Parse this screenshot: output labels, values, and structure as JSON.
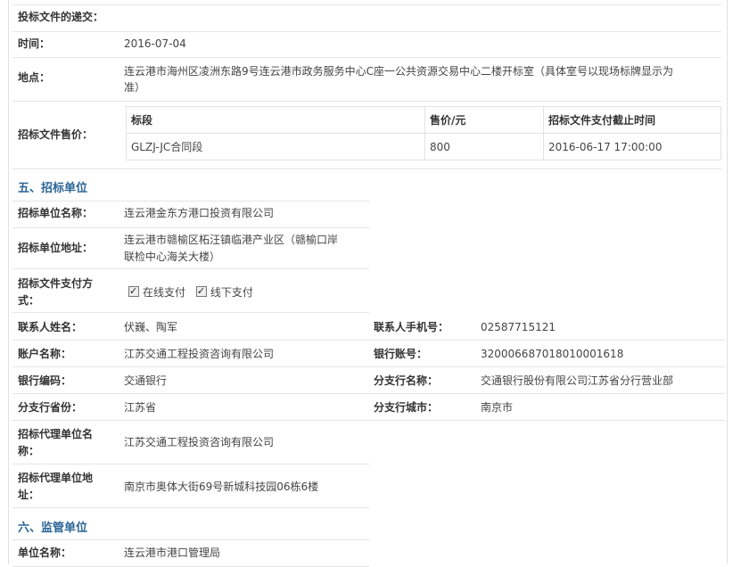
{
  "submission": {
    "label": "投标文件的递交："
  },
  "time": {
    "label": "时间：",
    "value": "2016-07-04"
  },
  "location": {
    "label": "地点：",
    "value_line1": "连云港市海州区凌洲东路9号连云港市政务服务中心C座一公共资源交易中心二楼开标室（具体室号以现场标牌显示为",
    "value_line2": "准）"
  },
  "price": {
    "label": "招标文件售价：",
    "headers": [
      "标段",
      "售价/元",
      "招标文件支付截止时间"
    ],
    "rows": [
      [
        "GLZJ-JC合同段",
        "800",
        "2016-06-17 17:00:00"
      ]
    ]
  },
  "section5": {
    "title": "五、招标单位"
  },
  "tenderer": {
    "name_label": "招标单位名称：",
    "name": "连云港金东方港口投资有限公司",
    "addr_label": "招标单位地址：",
    "addr_line1": "连云港市赣榆区柘汪镇临港产业区（赣榆口岸",
    "addr_line2": "联检中心海关大楼）",
    "pay_label_line1": "招标文件支付方",
    "pay_label_line2": "式：",
    "pay_online": "在线支付",
    "pay_offline": "线下支付",
    "contact_label": "联系人姓名：",
    "contact": "伏巍、陶军",
    "phone_label": "联系人手机号：",
    "phone": "02587715121",
    "account_name_label": "账户名称：",
    "account_name": "江苏交通工程投资咨询有限公司",
    "account_no_label": "银行账号：",
    "account_no": "32000668701801000161​8",
    "bank_code_label": "银行编码：",
    "bank_code": "交通银行",
    "branch_label": "分支行名称：",
    "branch": "交通银行股份有限公司江苏省分行营业部",
    "province_label": "分支行省份：",
    "province": "江苏省",
    "city_label": "分支行城市：",
    "city": "南京市",
    "agent_label_line1": "招标代理单位名",
    "agent_label_line2": "称：",
    "agent": "江苏交通工程投资咨询有限公司",
    "agent_addr_label_line1": "招标代理单位地",
    "agent_addr_label_line2": "址：",
    "agent_addr": "南京市奥体大街69号新城科技园06栋6楼"
  },
  "section6": {
    "title": "六、监管单位"
  },
  "supervisor": {
    "label": "单位名称：",
    "value": "连云港市港口管理局"
  }
}
